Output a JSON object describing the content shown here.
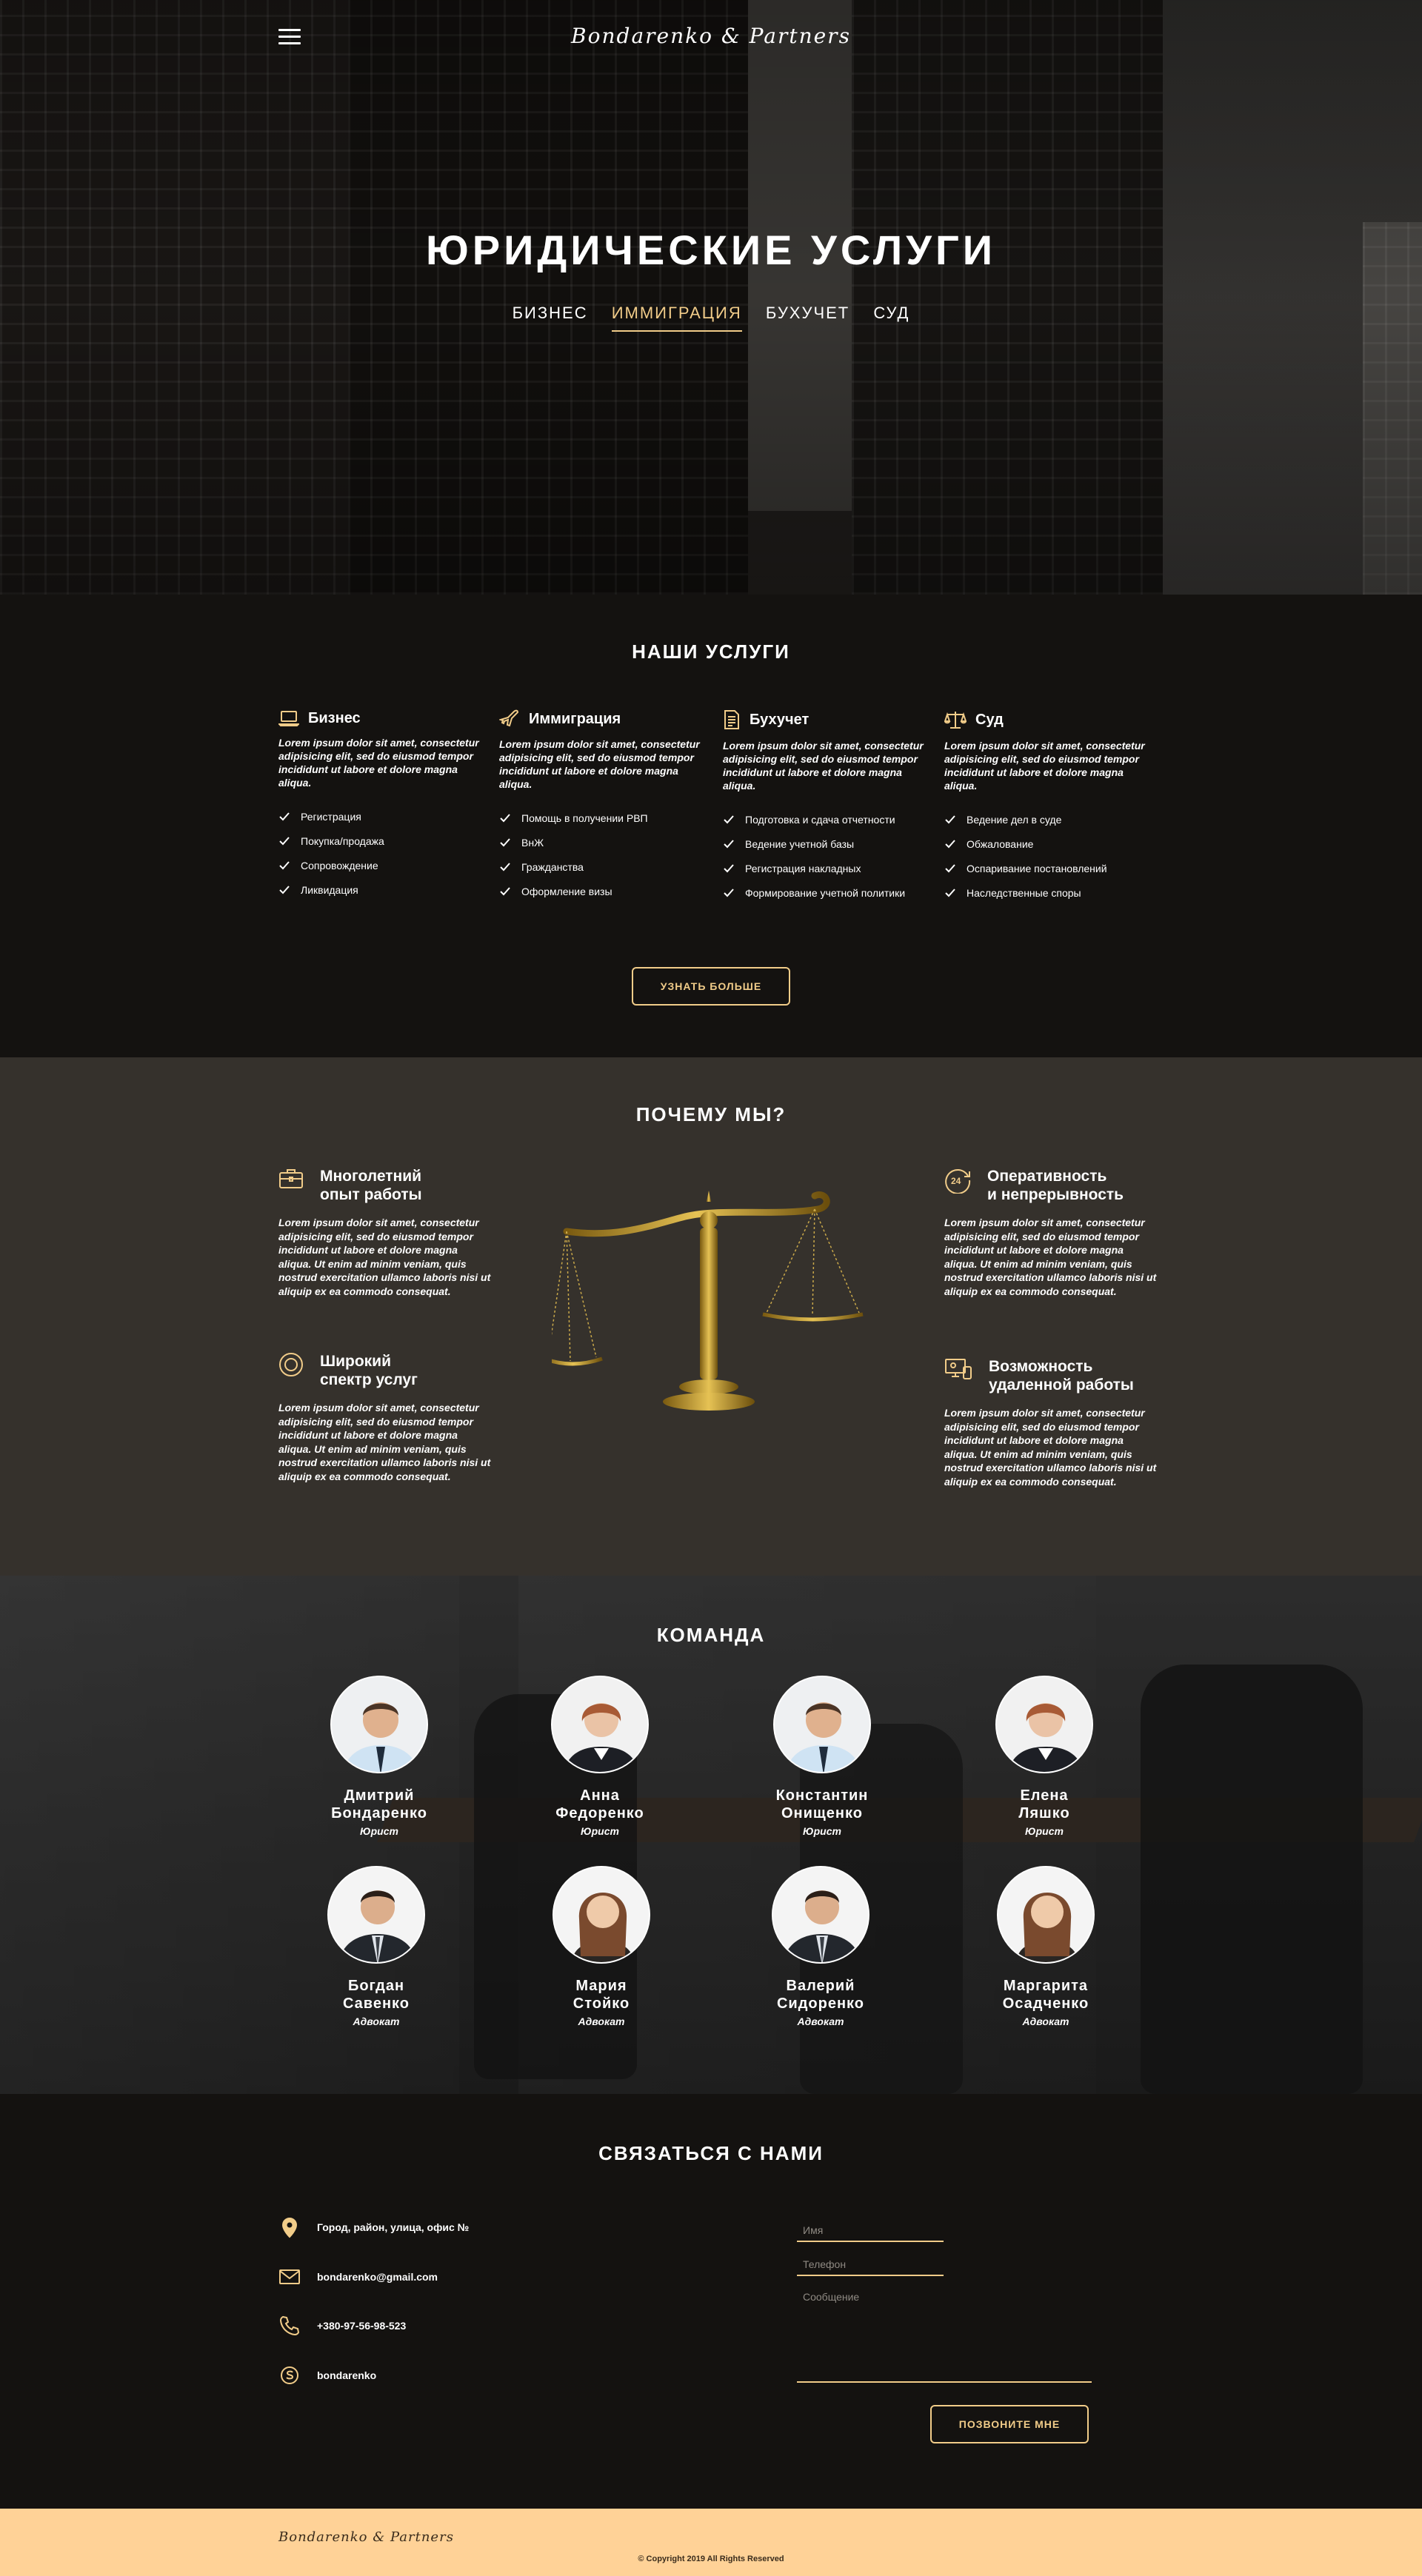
{
  "colors": {
    "accent": "#f1cc89",
    "dark": "#141210",
    "mid": "#35312c",
    "footer": "#ffd297"
  },
  "header": {
    "menu_icon": "hamburger-icon",
    "logo": "Bondarenko & Partners",
    "title": "ЮРИДИЧЕСКИЕ УСЛУГИ",
    "tabs": [
      {
        "label": "БИЗНЕС",
        "active": false
      },
      {
        "label": "ИММИГРАЦИЯ",
        "active": true
      },
      {
        "label": "БУХУЧЕТ",
        "active": false
      },
      {
        "label": "СУД",
        "active": false
      }
    ]
  },
  "services": {
    "title": "НАШИ УСЛУГИ",
    "button": "УЗНАТЬ БОЛЬШЕ",
    "columns": [
      {
        "icon": "laptop-icon",
        "title": "Бизнес",
        "desc": "Lorem ipsum dolor sit amet, consectetur adipisicing elit, sed do eiusmod tempor incididunt ut labore et dolore magna aliqua.",
        "items": [
          "Регистрация",
          "Покупка/продажа",
          "Сопровождение",
          "Ликвидация"
        ]
      },
      {
        "icon": "airplane-icon",
        "title": "Иммиграция",
        "desc": "Lorem ipsum dolor sit amet, consectetur adipisicing elit, sed do eiusmod tempor incididunt ut labore et dolore magna aliqua.",
        "items": [
          "Помощь в получении РВП",
          "ВнЖ",
          "Гражданства",
          "Оформление визы"
        ]
      },
      {
        "icon": "document-icon",
        "title": "Бухучет",
        "desc": "Lorem ipsum dolor sit amet, consectetur adipisicing elit, sed do eiusmod tempor incididunt ut labore et dolore magna aliqua.",
        "items": [
          "Подготовка и сдача отчетности",
          "Ведение учетной базы",
          "Регистрация накладных",
          "Формирование учетной политики"
        ]
      },
      {
        "icon": "scales-icon",
        "title": "Суд",
        "desc": "Lorem ipsum dolor sit amet, consectetur adipisicing elit, sed do eiusmod tempor incididunt ut labore et dolore magna aliqua.",
        "items": [
          "Ведение дел в суде",
          "Обжалование",
          "Оспаривание постановлений",
          "Наследственные споры"
        ]
      }
    ]
  },
  "why": {
    "title": "ПОЧЕМУ МЫ?",
    "items": [
      {
        "icon": "briefcase-icon",
        "title1": "Многолетний",
        "title2": "опыт работы",
        "desc": "Lorem ipsum dolor sit amet, consectetur adipisicing elit, sed do eiusmod tempor incididunt ut labore et dolore magna aliqua. Ut enim ad minim veniam, quis nostrud exercitation ullamco laboris nisi ut aliquip ex ea commodo consequat."
      },
      {
        "icon": "target-icon",
        "title1": "Широкий",
        "title2": "спектр услуг",
        "desc": "Lorem ipsum dolor sit amet, consectetur adipisicing elit, sed do eiusmod tempor incididunt ut labore et dolore magna aliqua. Ut enim ad minim veniam, quis nostrud exercitation ullamco laboris nisi ut aliquip ex ea commodo consequat."
      },
      {
        "icon": "clock-24-icon",
        "title1": "Оперативность",
        "title2": "и непрерывность",
        "desc": "Lorem ipsum dolor sit amet, consectetur adipisicing elit, sed do eiusmod tempor incididunt ut labore et dolore magna aliqua. Ut enim ad minim veniam, quis nostrud exercitation ullamco laboris nisi ut aliquip ex ea commodo consequat."
      },
      {
        "icon": "remote-work-icon",
        "title1": "Возможность",
        "title2": "удаленной работы",
        "desc": "Lorem ipsum dolor sit amet, consectetur adipisicing elit, sed do eiusmod tempor incididunt ut labore et dolore magna aliqua. Ut enim ad minim veniam, quis nostrud exercitation ullamco laboris nisi ut aliquip ex ea commodo consequat."
      }
    ]
  },
  "team": {
    "title": "КОМАНДА",
    "members": [
      {
        "first": "Дмитрий",
        "last": "Бондаренко",
        "role": "Юрист"
      },
      {
        "first": "Анна",
        "last": "Федоренко",
        "role": "Юрист"
      },
      {
        "first": "Константин",
        "last": "Онищенко",
        "role": "Юрист"
      },
      {
        "first": "Елена",
        "last": "Ляшко",
        "role": "Юрист"
      },
      {
        "first": "Богдан",
        "last": "Савенко",
        "role": "Адвокат"
      },
      {
        "first": "Мария",
        "last": "Стойко",
        "role": "Адвокат"
      },
      {
        "first": "Валерий",
        "last": "Сидоренко",
        "role": "Адвокат"
      },
      {
        "first": "Маргарита",
        "last": "Осадченко",
        "role": "Адвокат"
      }
    ]
  },
  "contact": {
    "title": "СВЯЗАТЬСЯ С НАМИ",
    "address": "Город, район, улица, офис №",
    "email": "bondarenko@gmail.com",
    "phone": "+380-97-56-98-523",
    "skype": "bondarenko",
    "form": {
      "name_placeholder": "Имя",
      "phone_placeholder": "Телефон",
      "message_placeholder": "Сообщение",
      "submit": "ПОЗВОНИТЕ МНЕ"
    }
  },
  "footer": {
    "logo": "Bondarenko & Partners",
    "copyright": "© Copyright 2019 All Rights Reserved"
  }
}
